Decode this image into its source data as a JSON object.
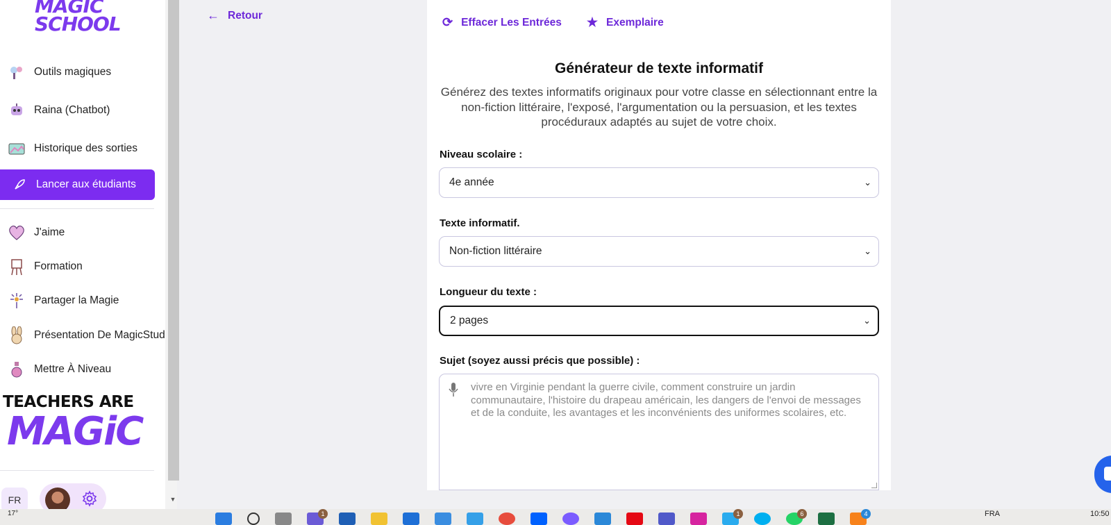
{
  "sidebar": {
    "logo_line1": "MAGIC",
    "logo_line2": "SCHOOL",
    "items": [
      {
        "label": "Outils magiques",
        "icon": "magic-tools-icon"
      },
      {
        "label": "Raina (Chatbot)",
        "icon": "robot-icon"
      },
      {
        "label": "Historique des sorties",
        "icon": "history-icon"
      },
      {
        "label": "Lancer aux étudiants",
        "icon": "rocket-icon"
      },
      {
        "label": "J'aime",
        "icon": "heart-icon"
      },
      {
        "label": "Formation",
        "icon": "easel-icon"
      },
      {
        "label": "Partager la Magie",
        "icon": "sparkle-wand-icon"
      },
      {
        "label": "Présentation De MagicStudent",
        "icon": "bunny-icon"
      },
      {
        "label": "Mettre À Niveau",
        "icon": "potion-icon"
      }
    ],
    "teachers_line1": "TEACHERS ARE",
    "teachers_line2": "MAGiC",
    "lang": "FR"
  },
  "main": {
    "back_label": "Retour",
    "clear_label": "Effacer Les Entrées",
    "example_label": "Exemplaire",
    "title": "Générateur de texte informatif",
    "description": "Générez des textes informatifs originaux pour votre classe en sélectionnant entre la non-fiction littéraire, l'exposé, l'argumentation ou la persuasion, et les textes procéduraux adaptés au sujet de votre choix.",
    "fields": {
      "grade_label": "Niveau scolaire :",
      "grade_value": "4e année",
      "text_type_label": "Texte informatif.",
      "text_type_value": "Non-fiction littéraire",
      "length_label": "Longueur du texte :",
      "length_value": "2 pages",
      "topic_label": "Sujet (soyez aussi précis que possible) :",
      "topic_placeholder": "vivre en Virginie pendant la guerre civile, comment construire un jardin communautaire, l'histoire du drapeau américain, les dangers de l'envoi de messages et de la conduite, les avantages et les inconvénients des uniformes scolaires, etc."
    }
  },
  "taskbar": {
    "temperature": "17°",
    "language": "FRA",
    "time": "10:50",
    "badges": [
      "1",
      "1",
      "6",
      "4"
    ]
  },
  "colors": {
    "accent": "#7c2cf0",
    "link": "#6d28d9"
  }
}
